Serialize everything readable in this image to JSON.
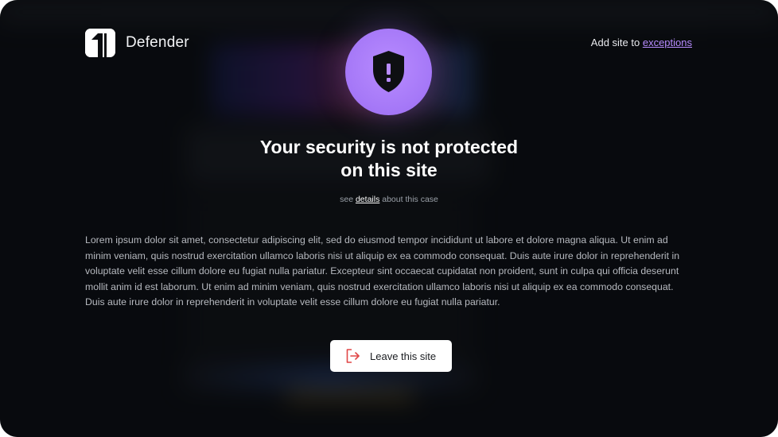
{
  "brand": {
    "name": "Defender",
    "logo_icon": "defender-logo-icon"
  },
  "top_action": {
    "prefix": "Add site to ",
    "link_label": "exceptions"
  },
  "hero": {
    "icon": "shield-alert-icon",
    "title_line1": "Your security is not protected",
    "title_line2": "on this site",
    "sub_prefix": "see ",
    "sub_link": "details",
    "sub_suffix": " about this case"
  },
  "body_text": "Lorem ipsum dolor sit amet, consectetur adipiscing elit, sed do eiusmod tempor incididunt ut labore et dolore magna aliqua. Ut enim ad minim veniam, quis nostrud exercitation ullamco laboris nisi ut aliquip ex ea commodo consequat. Duis aute irure dolor in reprehenderit in voluptate velit esse cillum dolore eu fugiat nulla pariatur. Excepteur sint occaecat cupidatat non proident, sunt in culpa qui officia deserunt mollit anim id est laborum. Ut enim ad minim veniam, quis nostrud exercitation ullamco laboris nisi ut aliquip ex ea commodo consequat. Duis aute irure dolor in reprehenderit in voluptate velit esse cillum dolore eu fugiat nulla pariatur.",
  "leave_button": {
    "label": "Leave this site",
    "icon": "exit-icon"
  },
  "colors": {
    "accent": "#b78cff",
    "background": "#0b0d10",
    "exit_icon": "#e04646"
  }
}
